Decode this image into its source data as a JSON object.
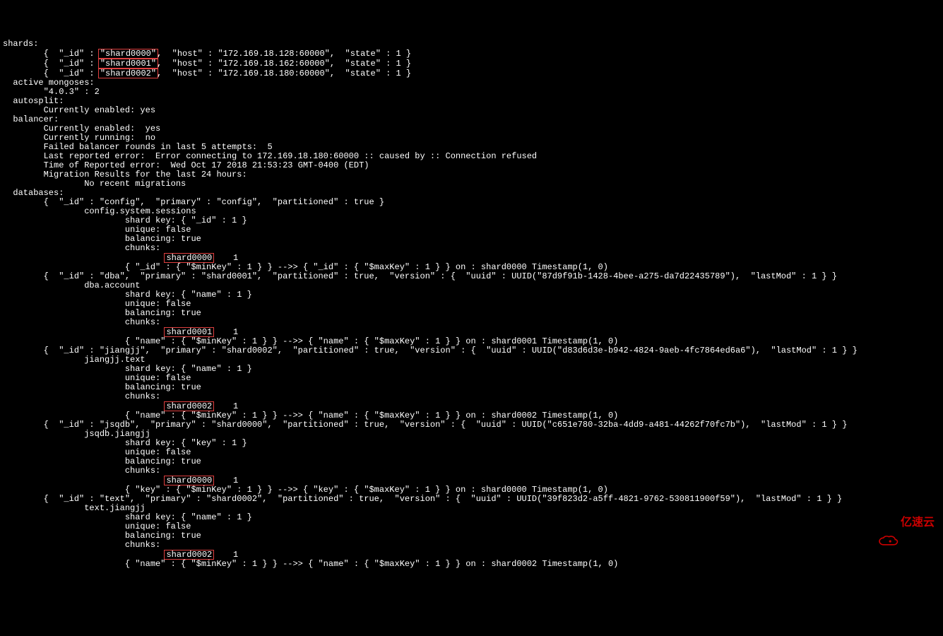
{
  "shards_header": "shards:",
  "shard0_pre": "        {  \"_id\" : ",
  "shard0_id": "\"shard0000\"",
  "shard0_post": ",  \"host\" : \"172.169.18.128:60000\",  \"state\" : 1 }",
  "shard1_pre": "        {  \"_id\" : ",
  "shard1_id": "\"shard0001\"",
  "shard1_post": ",  \"host\" : \"172.169.18.162:60000\",  \"state\" : 1 }",
  "shard2_pre": "        {  \"_id\" : ",
  "shard2_id": "\"shard0002\"",
  "shard2_post": ",  \"host\" : \"172.169.18.180:60000\",  \"state\" : 1 }",
  "active_mongoses": "  active mongoses:",
  "mongos_ver": "        \"4.0.3\" : 2",
  "autosplit": "  autosplit:",
  "autosplit_enabled": "        Currently enabled: yes",
  "balancer": "  balancer:",
  "bal_enabled": "        Currently enabled:  yes",
  "bal_running": "        Currently running:  no",
  "bal_failed": "        Failed balancer rounds in last 5 attempts:  5",
  "bal_error": "        Last reported error:  Error connecting to 172.169.18.180:60000 :: caused by :: Connection refused",
  "bal_time": "        Time of Reported error:  Wed Oct 17 2018 21:53:23 GMT-0400 (EDT)",
  "bal_mig": "        Migration Results for the last 24 hours: ",
  "bal_nomig": "                No recent migrations",
  "databases": "  databases:",
  "db_config": "        {  \"_id\" : \"config\",  \"primary\" : \"config\",  \"partitioned\" : true }",
  "cfg_sessions": "                config.system.sessions",
  "cfg_shardkey": "                        shard key: { \"_id\" : 1 }",
  "cfg_unique": "                        unique: false",
  "cfg_balancing": "                        balancing: true",
  "cfg_chunks": "                        chunks:",
  "cfg_chunk_pre": "                                ",
  "cfg_chunk_id": "shard0000",
  "cfg_chunk_post": "    1",
  "cfg_range": "                        { \"_id\" : { \"$minKey\" : 1 } } -->> { \"_id\" : { \"$maxKey\" : 1 } } on : shard0000 Timestamp(1, 0) ",
  "db_dba": "        {  \"_id\" : \"dba\",  \"primary\" : \"shard0001\",  \"partitioned\" : true,  \"version\" : {  \"uuid\" : UUID(\"87d9f91b-1428-4bee-a275-da7d22435789\"),  \"lastMod\" : 1 } }",
  "dba_acct": "                dba.account",
  "dba_shardkey": "                        shard key: { \"name\" : 1 }",
  "dba_unique": "                        unique: false",
  "dba_balancing": "                        balancing: true",
  "dba_chunks": "                        chunks:",
  "dba_chunk_pre": "                                ",
  "dba_chunk_id": "shard0001",
  "dba_chunk_post": "    1",
  "dba_range": "                        { \"name\" : { \"$minKey\" : 1 } } -->> { \"name\" : { \"$maxKey\" : 1 } } on : shard0001 Timestamp(1, 0) ",
  "db_jiangjj": "        {  \"_id\" : \"jiangjj\",  \"primary\" : \"shard0002\",  \"partitioned\" : true,  \"version\" : {  \"uuid\" : UUID(\"d83d6d3e-b942-4824-9aeb-4fc7864ed6a6\"),  \"lastMod\" : 1 } }",
  "jj_text": "                jiangjj.text",
  "jj_shardkey": "                        shard key: { \"name\" : 1 }",
  "jj_unique": "                        unique: false",
  "jj_balancing": "                        balancing: true",
  "jj_chunks": "                        chunks:",
  "jj_chunk_pre": "                                ",
  "jj_chunk_id": "shard0002",
  "jj_chunk_post": "    1",
  "jj_range": "                        { \"name\" : { \"$minKey\" : 1 } } -->> { \"name\" : { \"$maxKey\" : 1 } } on : shard0002 Timestamp(1, 0) ",
  "db_jsqdb": "        {  \"_id\" : \"jsqdb\",  \"primary\" : \"shard0000\",  \"partitioned\" : true,  \"version\" : {  \"uuid\" : UUID(\"c651e780-32ba-4dd9-a481-44262f70fc7b\"),  \"lastMod\" : 1 } }",
  "jsq_tbl": "                jsqdb.jiangjj",
  "jsq_shardkey": "                        shard key: { \"key\" : 1 }",
  "jsq_unique": "                        unique: false",
  "jsq_balancing": "                        balancing: true",
  "jsq_chunks": "                        chunks:",
  "jsq_chunk_pre": "                                ",
  "jsq_chunk_id": "shard0000",
  "jsq_chunk_post": "    1",
  "jsq_range": "                        { \"key\" : { \"$minKey\" : 1 } } -->> { \"key\" : { \"$maxKey\" : 1 } } on : shard0000 Timestamp(1, 0) ",
  "db_text": "        {  \"_id\" : \"text\",  \"primary\" : \"shard0002\",  \"partitioned\" : true,  \"version\" : {  \"uuid\" : UUID(\"39f823d2-a5ff-4821-9762-530811900f59\"),  \"lastMod\" : 1 } }",
  "txt_tbl": "                text.jiangjj",
  "txt_shardkey": "                        shard key: { \"name\" : 1 }",
  "txt_unique": "                        unique: false",
  "txt_balancing": "                        balancing: true",
  "txt_chunks": "                        chunks:",
  "txt_chunk_pre": "                                ",
  "txt_chunk_id": "shard0002",
  "txt_chunk_post": "    1",
  "txt_range": "                        { \"name\" : { \"$minKey\" : 1 } } -->> { \"name\" : { \"$maxKey\" : 1 } } on : shard0002 Timestamp(1, 0) ",
  "logo_text": "亿速云"
}
